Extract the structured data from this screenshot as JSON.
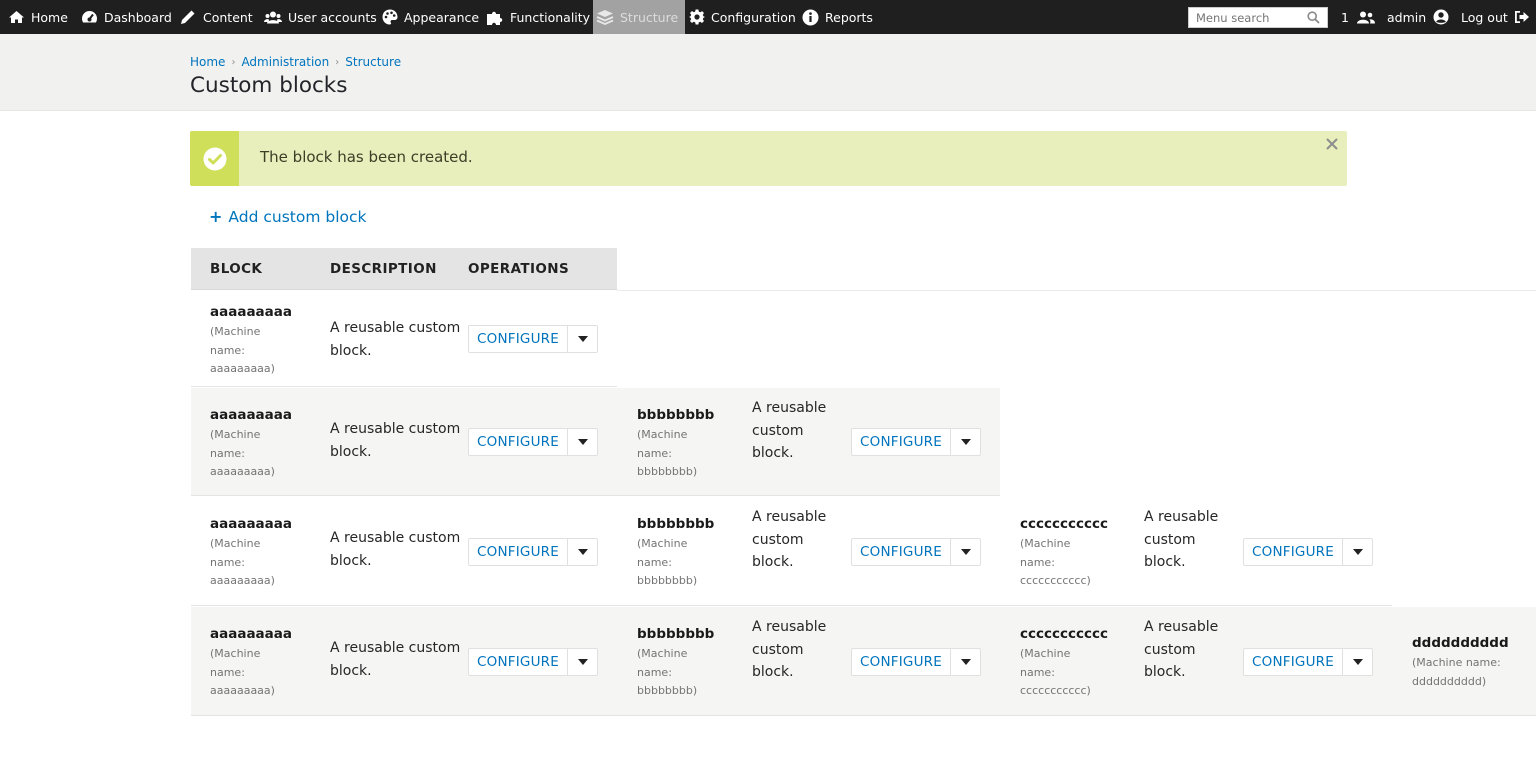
{
  "toolbar": {
    "items": [
      {
        "label": "Home",
        "icon": "home-icon"
      },
      {
        "label": "Dashboard",
        "icon": "dashboard-icon"
      },
      {
        "label": "Content",
        "icon": "pencil-icon"
      },
      {
        "label": "User accounts",
        "icon": "users-icon"
      },
      {
        "label": "Appearance",
        "icon": "palette-icon"
      },
      {
        "label": "Functionality",
        "icon": "puzzle-icon"
      },
      {
        "label": "Structure",
        "icon": "layers-icon",
        "active": true
      },
      {
        "label": "Configuration",
        "icon": "gear-icon"
      },
      {
        "label": "Reports",
        "icon": "info-icon"
      }
    ],
    "search_placeholder": "Menu search",
    "user_count": "1",
    "user_name": "admin",
    "logout_label": "Log out"
  },
  "breadcrumb": [
    "Home",
    "Administration",
    "Structure"
  ],
  "page_title": "Custom blocks",
  "message": {
    "text": "The block has been created.",
    "status": "success"
  },
  "add_link": "Add custom block",
  "table": {
    "headers": [
      "BLOCK",
      "DESCRIPTION",
      "OPERATIONS"
    ],
    "rows": [
      [
        {
          "title": "aaaaaaaaa",
          "machine": "(Machine name: aaaaaaaaa)",
          "description": "A reusable custom block.",
          "operation": "CONFIGURE"
        }
      ],
      [
        {
          "title": "aaaaaaaaa",
          "machine": "(Machine name: aaaaaaaaa)",
          "description": "A reusable custom block.",
          "operation": "CONFIGURE"
        },
        {
          "title": "bbbbbbbb",
          "machine": "(Machine name: bbbbbbbb)",
          "description": "A reusable custom block.",
          "operation": "CONFIGURE"
        }
      ],
      [
        {
          "title": "aaaaaaaaa",
          "machine": "(Machine name: aaaaaaaaa)",
          "description": "A reusable custom block.",
          "operation": "CONFIGURE"
        },
        {
          "title": "bbbbbbbb",
          "machine": "(Machine name: bbbbbbbb)",
          "description": "A reusable custom block.",
          "operation": "CONFIGURE"
        },
        {
          "title": "ccccccccccc",
          "machine": "(Machine name: ccccccccccc)",
          "description": "A reusable custom block.",
          "operation": "CONFIGURE"
        }
      ],
      [
        {
          "title": "aaaaaaaaa",
          "machine": "(Machine name: aaaaaaaaa)",
          "description": "A reusable custom block.",
          "operation": "CONFIGURE"
        },
        {
          "title": "bbbbbbbb",
          "machine": "(Machine name: bbbbbbbb)",
          "description": "A reusable custom block.",
          "operation": "CONFIGURE"
        },
        {
          "title": "ccccccccccc",
          "machine": "(Machine name: ccccccccccc)",
          "description": "A reusable custom block.",
          "operation": "CONFIGURE"
        },
        {
          "title": "dddddddddd",
          "machine": "(Machine name: dddddddddd)"
        }
      ]
    ]
  },
  "colors": {
    "toolbar_bg": "#1f1f1f",
    "link": "#0074bd",
    "success_bg": "#e8efbc",
    "success_icon_bg": "#cfdf59"
  }
}
